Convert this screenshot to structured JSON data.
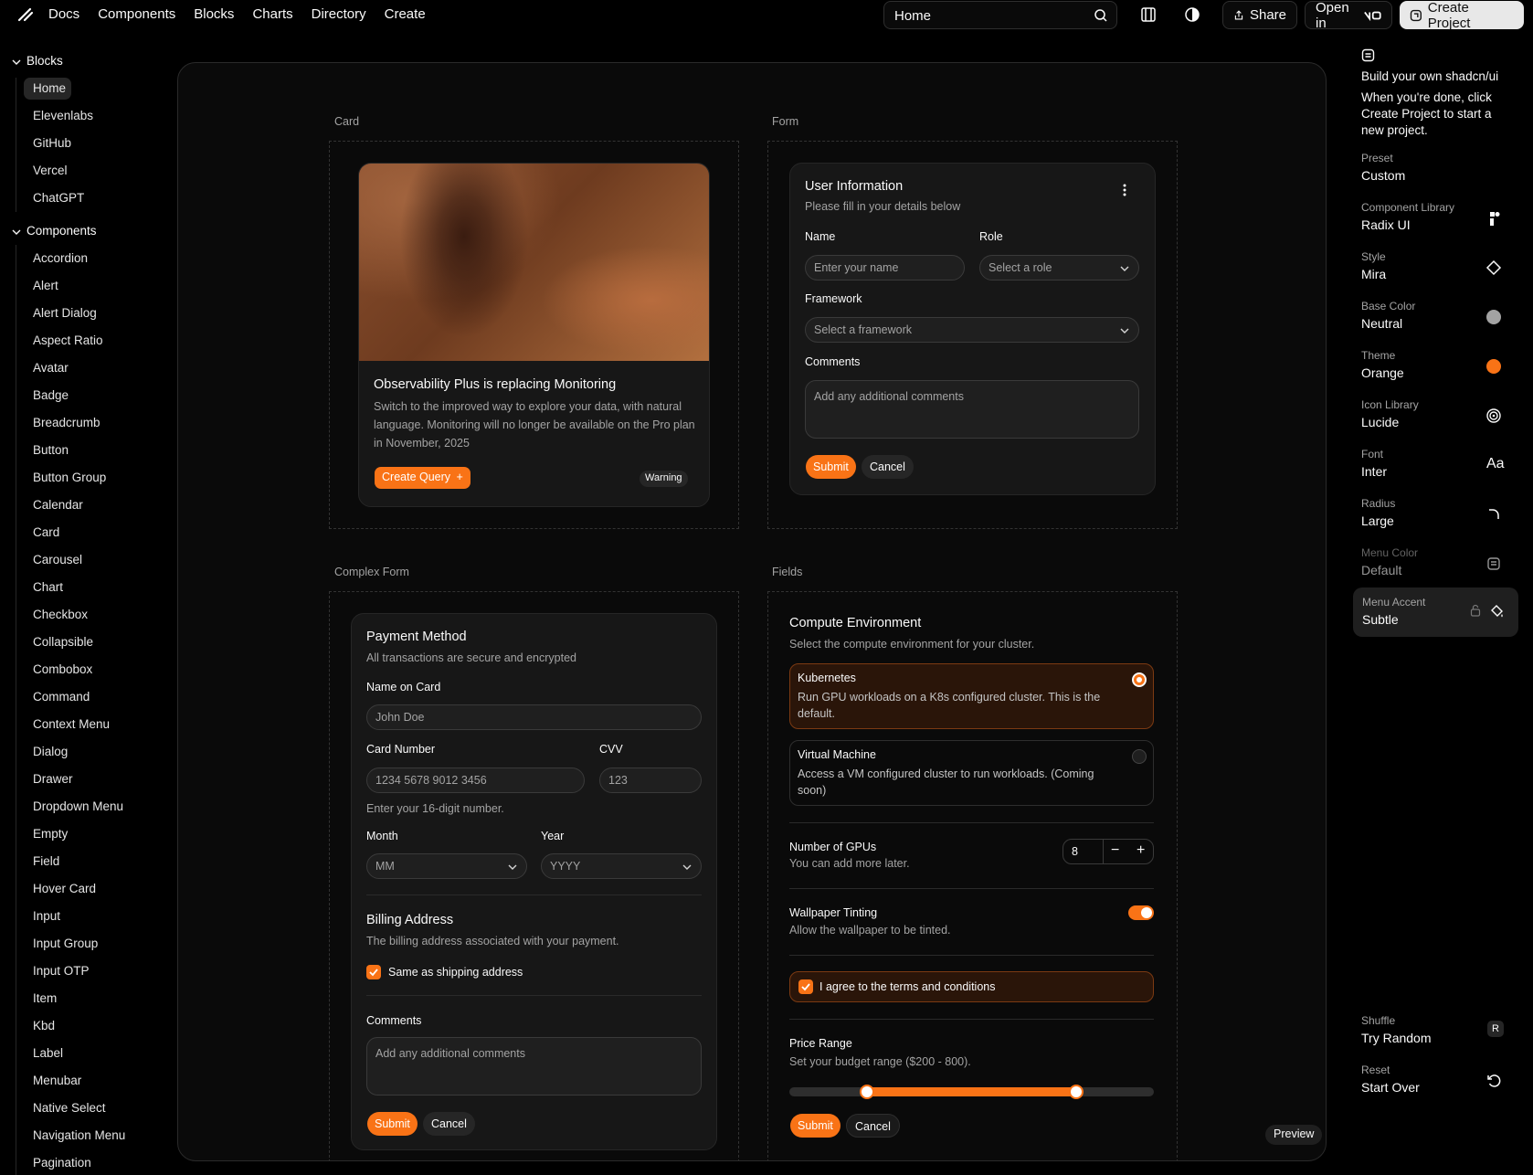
{
  "topbar": {
    "nav": [
      "Docs",
      "Components",
      "Blocks",
      "Charts",
      "Directory",
      "Create"
    ],
    "search_value": "Home",
    "share_label": "Share",
    "open_in_label": "Open in",
    "create_project_label": "Create Project",
    "icons": [
      "logo-icon",
      "search-icon",
      "panel-icon",
      "theme-toggle-icon",
      "share-icon",
      "v0-icon",
      "project-icon"
    ]
  },
  "sidebar": {
    "blocks_header": "Blocks",
    "blocks": [
      "Home",
      "Elevenlabs",
      "GitHub",
      "Vercel",
      "ChatGPT"
    ],
    "components_header": "Components",
    "components": [
      "Accordion",
      "Alert",
      "Alert Dialog",
      "Aspect Ratio",
      "Avatar",
      "Badge",
      "Breadcrumb",
      "Button",
      "Button Group",
      "Calendar",
      "Card",
      "Carousel",
      "Chart",
      "Checkbox",
      "Collapsible",
      "Combobox",
      "Command",
      "Context Menu",
      "Dialog",
      "Drawer",
      "Dropdown Menu",
      "Empty",
      "Field",
      "Hover Card",
      "Input",
      "Input Group",
      "Input OTP",
      "Item",
      "Kbd",
      "Label",
      "Menubar",
      "Native Select",
      "Navigation Menu",
      "Pagination"
    ]
  },
  "card_section": {
    "label": "Card",
    "title": "Observability Plus is replacing Monitoring",
    "description": "Switch to the improved way to explore your data, with natural language. Monitoring will no longer be available on the Pro plan in November, 2025",
    "button": "Create Query",
    "badge": "Warning"
  },
  "form_section": {
    "label": "Form",
    "title": "User Information",
    "subtitle": "Please fill in your details below",
    "name_label": "Name",
    "name_placeholder": "Enter your name",
    "role_label": "Role",
    "role_placeholder": "Select a role",
    "framework_label": "Framework",
    "framework_placeholder": "Select a framework",
    "comments_label": "Comments",
    "comments_placeholder": "Add any additional comments",
    "submit": "Submit",
    "cancel": "Cancel"
  },
  "complex_form": {
    "label": "Complex Form",
    "title": "Payment Method",
    "subtitle": "All transactions are secure and encrypted",
    "name_on_card_label": "Name on Card",
    "name_on_card_placeholder": "John Doe",
    "card_number_label": "Card Number",
    "card_number_placeholder": "1234 5678 9012 3456",
    "cvv_label": "CVV",
    "cvv_placeholder": "123",
    "card_hint": "Enter your 16-digit number.",
    "month_label": "Month",
    "month_placeholder": "MM",
    "year_label": "Year",
    "year_placeholder": "YYYY",
    "billing_title": "Billing Address",
    "billing_subtitle": "The billing address associated with your payment.",
    "same_as_shipping": "Same as shipping address",
    "same_as_shipping_checked": true,
    "comments_label": "Comments",
    "comments_placeholder": "Add any additional comments",
    "submit": "Submit",
    "cancel": "Cancel"
  },
  "fields": {
    "label": "Fields",
    "title": "Compute Environment",
    "subtitle": "Select the compute environment for your cluster.",
    "options": [
      {
        "title": "Kubernetes",
        "desc": "Run GPU workloads on a K8s configured cluster. This is the default.",
        "selected": true
      },
      {
        "title": "Virtual Machine",
        "desc": "Access a VM configured cluster to run workloads. (Coming soon)",
        "selected": false
      }
    ],
    "gpus_title": "Number of GPUs",
    "gpus_hint": "You can add more later.",
    "gpus_value": "8",
    "tint_title": "Wallpaper Tinting",
    "tint_hint": "Allow the wallpaper to be tinted.",
    "tint_on": true,
    "terms": "I agree to the terms and conditions",
    "terms_checked": true,
    "price_title": "Price Range",
    "price_hint": "Set your budget range ($200 - 800).",
    "price_min": 200,
    "price_max": 800,
    "submit": "Submit",
    "cancel": "Cancel"
  },
  "preview_label": "Preview",
  "right_panel": {
    "intro_title": "Build your own shadcn/ui",
    "intro_text": "When you're done, click Create Project to start a new project.",
    "rows": [
      {
        "key": "Preset",
        "value": "Custom",
        "icon": ""
      },
      {
        "key": "Component Library",
        "value": "Radix UI",
        "icon": "radix-icon"
      },
      {
        "key": "Style",
        "value": "Mira",
        "icon": "diamond-icon"
      },
      {
        "key": "Base Color",
        "value": "Neutral",
        "icon": "neutral-dot-icon"
      },
      {
        "key": "Theme",
        "value": "Orange",
        "icon": "orange-dot-icon"
      },
      {
        "key": "Icon Library",
        "value": "Lucide",
        "icon": "lucide-icon"
      },
      {
        "key": "Font",
        "value": "Inter",
        "icon": "font-icon"
      },
      {
        "key": "Radius",
        "value": "Large",
        "icon": "radius-icon"
      },
      {
        "key": "Menu Color",
        "value": "Default",
        "icon": "menu-icon"
      },
      {
        "key": "Menu Accent",
        "value": "Subtle",
        "icon": "paint-bucket-icon"
      }
    ],
    "font_glyph": "Aa",
    "shuffle_key": "Shuffle",
    "shuffle_value": "Try Random",
    "shuffle_kbd": "R",
    "reset_key": "Reset",
    "reset_value": "Start Over"
  },
  "colors": {
    "accent": "#f97316",
    "background": "#000000",
    "card": "#171717"
  }
}
